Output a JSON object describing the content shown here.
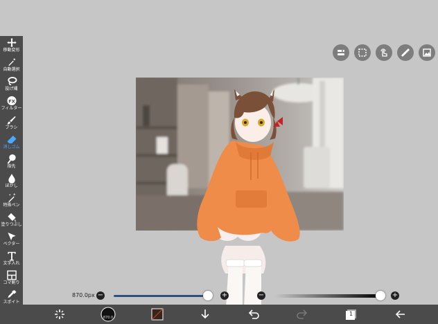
{
  "sidebar": {
    "items": [
      {
        "label": "移動変形",
        "icon": "move-icon",
        "active": false
      },
      {
        "label": "自動選択",
        "icon": "magic-wand-icon",
        "active": false
      },
      {
        "label": "投げ縄",
        "icon": "lasso-icon",
        "active": false
      },
      {
        "label": "フィルター",
        "icon": "fx-icon",
        "active": false
      },
      {
        "label": "ブラシ",
        "icon": "brush-icon",
        "active": false
      },
      {
        "label": "消しゴム",
        "icon": "eraser-icon",
        "active": true
      },
      {
        "label": "指先",
        "icon": "finger-icon",
        "active": false
      },
      {
        "label": "ぼかし",
        "icon": "blur-icon",
        "active": false
      },
      {
        "label": "特殊ペン",
        "icon": "special-pen-icon",
        "active": false
      },
      {
        "label": "塗りつぶし",
        "icon": "bucket-icon",
        "active": false
      },
      {
        "label": "ベクター",
        "icon": "vector-icon",
        "active": false
      },
      {
        "label": "文字入れ",
        "icon": "text-icon",
        "active": false
      },
      {
        "label": "コマ割り",
        "icon": "frame-divider-icon",
        "active": false
      },
      {
        "label": "スポイト",
        "icon": "eyedropper-icon",
        "active": false
      }
    ]
  },
  "top_icons": [
    "layer-settings-icon",
    "selection-icon",
    "gesture-icon",
    "ruler-icon",
    "material-icon"
  ],
  "brush": {
    "size_label": "870.0px",
    "size_fraction": 1.0,
    "opacity_fraction": 1.0
  },
  "bottom_bar": {
    "icons": [
      "transform-icon",
      "brush-size-icon",
      "color-icon",
      "download-icon",
      "undo-icon",
      "redo-icon",
      "layers-icon",
      "back-icon"
    ],
    "brush_size_value": "870.0",
    "layer_count": "1",
    "color": "#3a2418"
  },
  "colors": {
    "accent": "#4aa8ff",
    "toolbar": "#4b4b4b",
    "background": "#c6c6c6",
    "hoodie": "#f08c4a"
  }
}
